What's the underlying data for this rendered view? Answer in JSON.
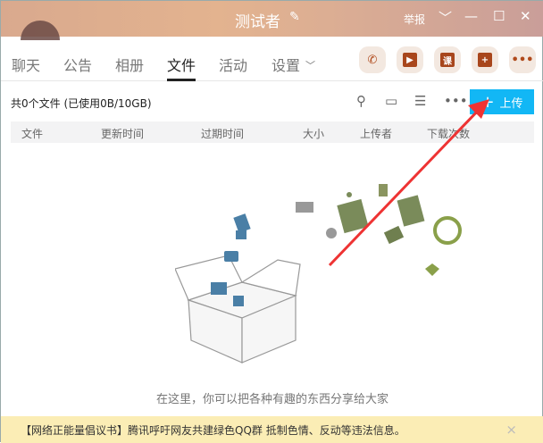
{
  "title": "测试者",
  "window": {
    "report": "举报",
    "dropdown": "﹀",
    "minimize": "—",
    "maximize": "☐",
    "close": "✕"
  },
  "tabs": [
    {
      "label": "聊天"
    },
    {
      "label": "公告"
    },
    {
      "label": "相册"
    },
    {
      "label": "文件",
      "active": true
    },
    {
      "label": "活动"
    },
    {
      "label": "设置"
    }
  ],
  "actions": {
    "course": "课"
  },
  "files": {
    "summary": "共0个文件 (已使用0B/10GB)",
    "upload_label": "上传",
    "columns": [
      "文件",
      "更新时间",
      "过期时间",
      "大小",
      "上传者",
      "下载次数"
    ],
    "empty_text": "在这里，你可以把各种有趣的东西分享给大家"
  },
  "notice": {
    "text": "【网络正能量倡议书】腾讯呼吁网友共建绿色QQ群 抵制色情、反动等违法信息。",
    "close": "×"
  },
  "colors": {
    "accent": "#12b7f5",
    "arrow": "#ee3333"
  }
}
